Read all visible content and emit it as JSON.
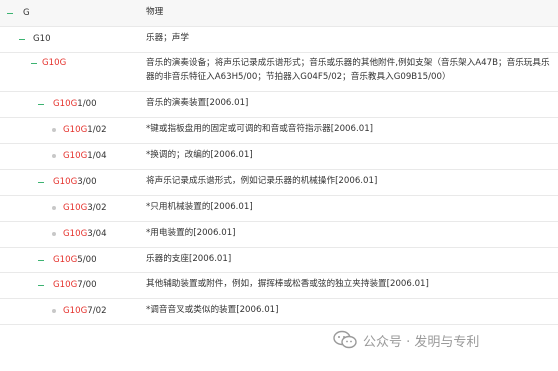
{
  "tree": {
    "rows": [
      {
        "code_red": "",
        "code_black": "G",
        "text": "物理",
        "level": 0,
        "marker": "dash"
      },
      {
        "code_red": "",
        "code_black": "G10",
        "text": "乐器；声学",
        "level": 1,
        "marker": "dash"
      },
      {
        "code_red": "G10G",
        "code_black": "",
        "text": "音乐的演奏设备；将声乐记录成乐谱形式；音乐或乐器的其他附件,例如支架（音乐架入A47B；音乐玩具乐器的非音乐特征入A63H5/00；节拍器入G04F5/02；音乐教具入G09B15/00）",
        "level": 2,
        "marker": "dash"
      },
      {
        "code_red": "G10G",
        "code_black": "1/00",
        "text": "音乐的演奏装置[2006.01]",
        "level": 3,
        "marker": "dash"
      },
      {
        "code_red": "G10G",
        "code_black": "1/02",
        "text": "*键或指板盘用的固定或可调的和音或音符指示器[2006.01]",
        "level": 4,
        "marker": "dot"
      },
      {
        "code_red": "G10G",
        "code_black": "1/04",
        "text": "*换调的；改编的[2006.01]",
        "level": 4,
        "marker": "dot"
      },
      {
        "code_red": "G10G",
        "code_black": "3/00",
        "text": "将声乐记录成乐谱形式，例如记录乐器的机械操作[2006.01]",
        "level": 3,
        "marker": "dash"
      },
      {
        "code_red": "G10G",
        "code_black": "3/02",
        "text": "*只用机械装置的[2006.01]",
        "level": 4,
        "marker": "dot"
      },
      {
        "code_red": "G10G",
        "code_black": "3/04",
        "text": "*用电装置的[2006.01]",
        "level": 4,
        "marker": "dot"
      },
      {
        "code_red": "G10G",
        "code_black": "5/00",
        "text": "乐器的支座[2006.01]",
        "level": 3,
        "marker": "dash"
      },
      {
        "code_red": "G10G",
        "code_black": "7/00",
        "text": "其他辅助装置或附件，例如，摒挥棒或松香或弦的独立夹持装置[2006.01]",
        "level": 3,
        "marker": "dash"
      },
      {
        "code_red": "G10G",
        "code_black": "7/02",
        "text": "*调音音叉或类似的装置[2006.01]",
        "level": 4,
        "marker": "dot"
      }
    ]
  },
  "watermark": {
    "text": "公众号 · 发明与专利",
    "icon": "wechat-icon"
  },
  "colors": {
    "code_red": "#e5322d",
    "dash_green": "#3cb371",
    "dot_gray": "#c8c8c8"
  }
}
